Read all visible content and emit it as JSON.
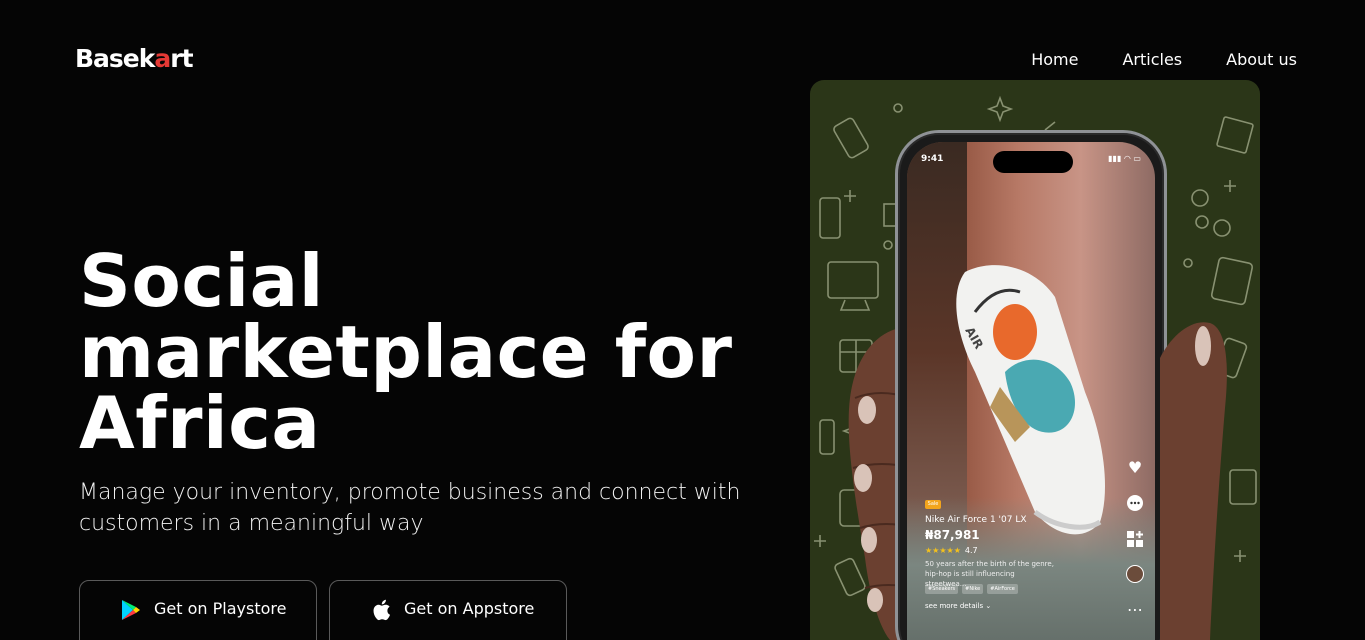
{
  "brand": {
    "logo_prefix": "Basek",
    "logo_mark": "a",
    "logo_suffix": "rt"
  },
  "nav": {
    "items": [
      "Home",
      "Articles",
      "About us"
    ]
  },
  "hero": {
    "title_lines": [
      "Social",
      "marketplace for",
      "Africa"
    ],
    "subtitle": "Manage your inventory, promote business and connect with customers in a meaningful way"
  },
  "buttons": {
    "playstore_label": "Get on Playstore",
    "appstore_label": "Get on Appstore"
  },
  "phone": {
    "time": "9:41",
    "status_icons": "▮▮▮ ◠ ▭",
    "tag": "Sale",
    "product_name": "Nike Air Force 1 '07 LX",
    "price": "₦87,981",
    "rating_stars": "★★★★★",
    "rating_value": "4.7",
    "description": "50 years after the birth of the genre, hip-hop is still influencing streetwea...",
    "tags": [
      "#Sneakers",
      "#Nike",
      "#AirForce"
    ],
    "see_more": "see more details ⌄"
  },
  "colors": {
    "background": "#050505",
    "panel": "#2b3618",
    "accent": "#e53935"
  },
  "icons": {
    "playstore": "play-store-icon",
    "appstore": "apple-icon"
  }
}
